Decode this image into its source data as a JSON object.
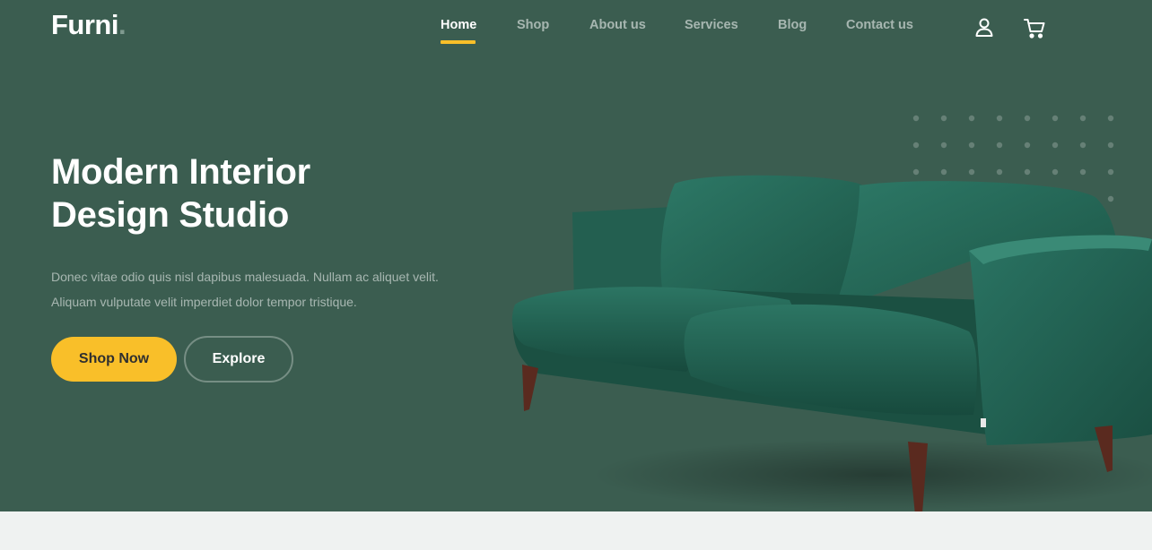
{
  "brand": {
    "name": "Furni",
    "dot": "."
  },
  "nav": {
    "items": [
      {
        "label": "Home",
        "active": true
      },
      {
        "label": "Shop"
      },
      {
        "label": "About us"
      },
      {
        "label": "Services"
      },
      {
        "label": "Blog"
      },
      {
        "label": "Contact us"
      }
    ],
    "icons": [
      "user-icon",
      "cart-icon"
    ]
  },
  "hero": {
    "title_line1": "Modern Interior",
    "title_line2": "Design Studio",
    "description": "Donec vitae odio quis nisl dapibus malesuada. Nullam ac aliquet velit. Aliquam vulputate velit imperdiet dolor tempor tristique.",
    "primary_button": "Shop Now",
    "secondary_button": "Explore",
    "image": "sofa-image"
  },
  "colors": {
    "hero_bg": "#3b5d50",
    "accent": "#f9bf29",
    "page_bg": "#eff2f1",
    "sofa": "#1f5c4c"
  }
}
